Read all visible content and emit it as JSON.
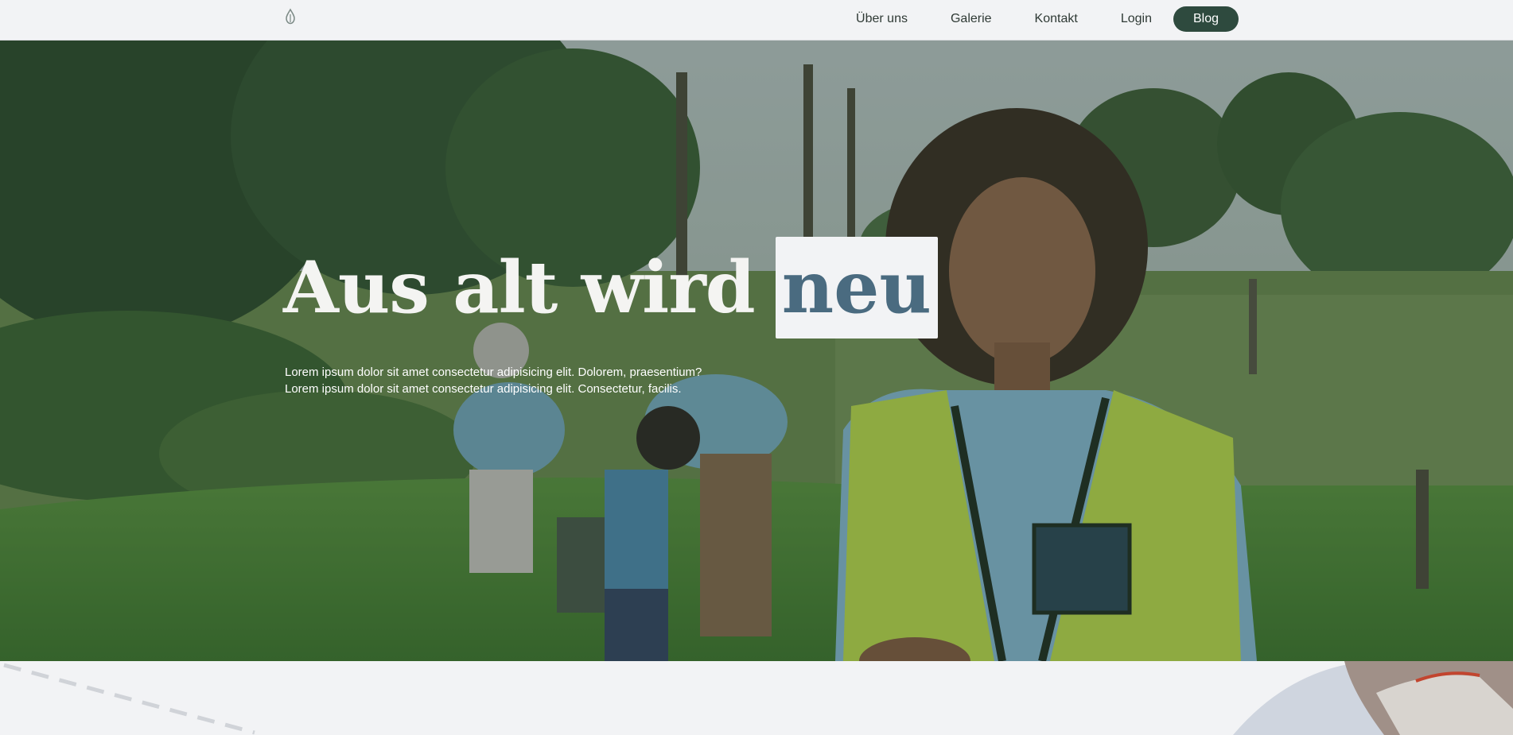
{
  "nav": {
    "logo_icon": "leaf-drop-icon",
    "links": [
      "Über uns",
      "Galerie",
      "Kontakt",
      "Login"
    ],
    "cta_label": "Blog",
    "cta_color": "#2e4a3e"
  },
  "hero": {
    "title_main": "Aus alt wird",
    "title_accent": "neu",
    "subtitle_line1": "Lorem ipsum dolor sit amet consectetur adipisicing elit. Dolorem, praesentium?",
    "subtitle_line2": "Lorem ipsum dolor sit amet consectetur adipisicing elit. Consectetur, facilis."
  }
}
